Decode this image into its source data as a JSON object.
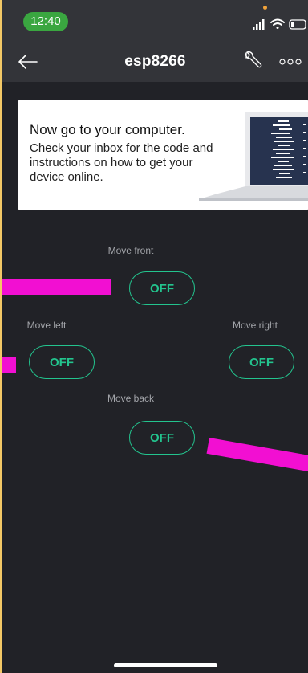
{
  "status_bar": {
    "time": "12:40"
  },
  "nav": {
    "title": "esp8266",
    "back_icon": "arrow-left-icon",
    "settings_icon": "wrench-icon",
    "more_icon": "more-dots-icon"
  },
  "card": {
    "title": "Now go to your computer.",
    "body": "Check your inbox for the code and instructions on how to get your device online.",
    "image_icon": "laptop-code-illustration"
  },
  "controls": {
    "front": {
      "label": "Move front",
      "state": "OFF"
    },
    "left": {
      "label": "Move left",
      "state": "OFF"
    },
    "right": {
      "label": "Move right",
      "state": "OFF"
    },
    "back": {
      "label": "Move back",
      "state": "OFF"
    }
  },
  "colors": {
    "background": "#212227",
    "bar": "#333439",
    "accent": "#23c48e",
    "time_pill": "#3aa640",
    "annotation": "#f20fd2",
    "outer": "#f3c866"
  }
}
